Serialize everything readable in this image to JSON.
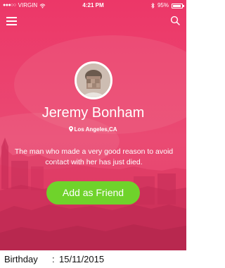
{
  "status_bar": {
    "carrier": "VIRGIN",
    "signal": "●●●○○",
    "time": "4:21 PM",
    "battery_text": "95%",
    "battery_level": 0.95
  },
  "header": {
    "menu_icon": "hamburger-menu-icon",
    "search_icon": "search-icon"
  },
  "profile": {
    "name": "Jeremy Bonham",
    "location": "Los Angeles,CA",
    "bio": "The man who made a very good reason to avoid contact with her has just died.",
    "action_label": "Add as Friend"
  },
  "details": {
    "birthday_label": "Birthday",
    "separator": ":",
    "birthday_value": "15/11/2015"
  },
  "colors": {
    "hero_pink": "#e8436c",
    "button_green": "#6fd32b",
    "text_white": "#ffffff"
  }
}
